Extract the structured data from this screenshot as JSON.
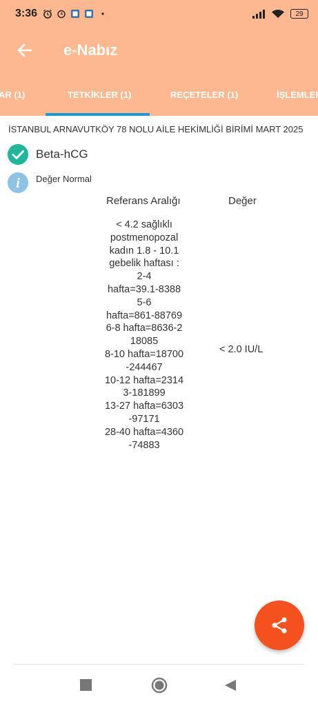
{
  "status_bar": {
    "time": "3:36",
    "battery": "29",
    "icons": [
      "alarm-icon",
      "clock-icon",
      "gallery-icon",
      "gallery-icon",
      "dot-icon",
      "signal-icon",
      "wifi-icon",
      "battery-icon"
    ]
  },
  "app_bar": {
    "title": "e-Nabız",
    "back_icon": "back-arrow-icon"
  },
  "tabs": [
    {
      "label": "AR (1)"
    },
    {
      "label": "TETKİKLER (1)",
      "selected": true
    },
    {
      "label": "REÇETELER (1)"
    },
    {
      "label": "İŞLEMLER"
    }
  ],
  "record": {
    "facility": "İSTANBUL ARNAVUTKÖY 78 NOLU AİLE HEKİMLİĞİ BİRİMİ MART 2025",
    "test_name": "Beta-hCG",
    "status": "Değer Normal",
    "ref_header": "Referans Aralığı",
    "value_header": "Değer",
    "ref_lines": [
      "< 4.2 sağlıklı",
      "postmenopozal",
      "kadın 1.8 - 10.1",
      "gebelik haftası :",
      "2-4",
      "hafta=39.1-8388",
      "5-6",
      "hafta=861-88769",
      "6-8 hafta=8636-2",
      "18085",
      "8-10 hafta=18700",
      "-244467",
      "10-12 hafta=2314",
      "3-181899",
      "13-27 hafta=6303",
      "-97171",
      "28-40 hafta=4360",
      "-74883"
    ],
    "value": "< 2.0 IU/L"
  },
  "fab": {
    "icon": "share-icon"
  },
  "nav_bar": {
    "icons": [
      "recents-square-icon",
      "home-circle-icon",
      "back-triangle-icon"
    ]
  },
  "colors": {
    "header": "#fdb88f",
    "tab_indicator": "#1a9bd7",
    "fab": "#f4511e",
    "check": "#20b69a",
    "info": "#8ec3e6"
  }
}
